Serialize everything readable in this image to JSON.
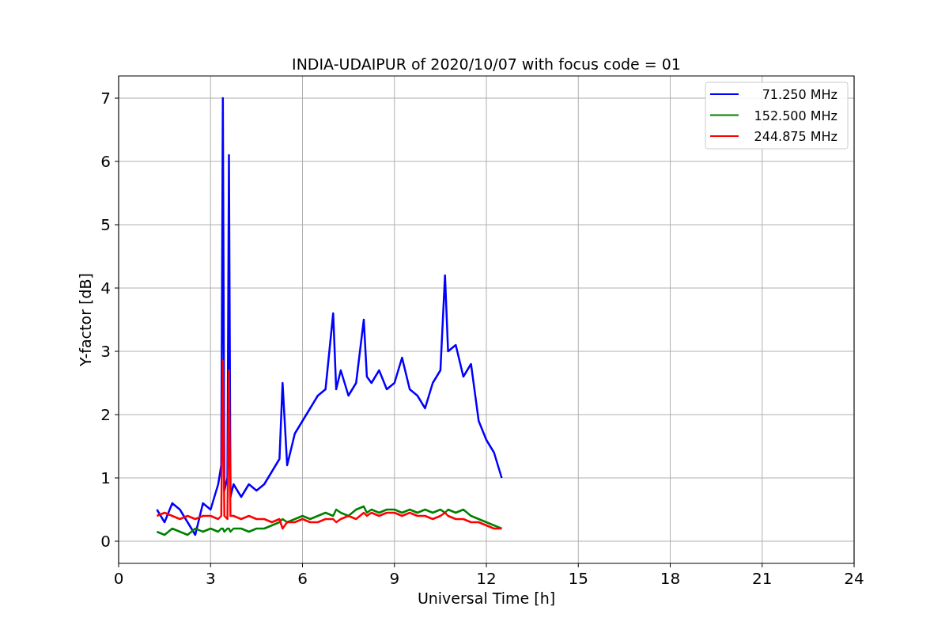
{
  "chart_data": {
    "type": "line",
    "title": "INDIA-UDAIPUR of 2020/10/07 with focus code = 01",
    "xlabel": "Universal Time [h]",
    "ylabel": "Y-factor [dB]",
    "x": [
      1.25,
      1.5,
      1.75,
      2.0,
      2.25,
      2.5,
      2.75,
      3.0,
      3.25,
      3.35,
      3.4,
      3.45,
      3.55,
      3.6,
      3.65,
      3.75,
      4.0,
      4.25,
      4.5,
      4.75,
      5.0,
      5.25,
      5.35,
      5.5,
      5.75,
      6.0,
      6.25,
      6.5,
      6.75,
      7.0,
      7.1,
      7.25,
      7.5,
      7.75,
      8.0,
      8.1,
      8.25,
      8.5,
      8.75,
      9.0,
      9.25,
      9.5,
      9.75,
      10.0,
      10.25,
      10.5,
      10.65,
      10.75,
      11.0,
      11.25,
      11.5,
      11.75,
      12.0,
      12.25,
      12.5
    ],
    "series": [
      {
        "name": "71.250 MHz",
        "color": "#0000ff",
        "values": [
          0.5,
          0.3,
          0.6,
          0.5,
          0.3,
          0.1,
          0.6,
          0.5,
          0.9,
          1.2,
          7.0,
          0.8,
          1.0,
          6.1,
          0.7,
          0.9,
          0.7,
          0.9,
          0.8,
          0.9,
          1.1,
          1.3,
          2.5,
          1.2,
          1.7,
          1.9,
          2.1,
          2.3,
          2.4,
          3.6,
          2.4,
          2.7,
          2.3,
          2.5,
          3.5,
          2.6,
          2.5,
          2.7,
          2.4,
          2.5,
          2.9,
          2.4,
          2.3,
          2.1,
          2.5,
          2.7,
          4.2,
          3.0,
          3.1,
          2.6,
          2.8,
          1.9,
          1.6,
          1.4,
          1.0
        ]
      },
      {
        "name": "152.500 MHz",
        "color": "#008000",
        "values": [
          0.15,
          0.1,
          0.2,
          0.15,
          0.1,
          0.2,
          0.15,
          0.2,
          0.15,
          0.2,
          0.2,
          0.15,
          0.2,
          0.2,
          0.15,
          0.2,
          0.2,
          0.15,
          0.2,
          0.2,
          0.25,
          0.3,
          0.35,
          0.3,
          0.35,
          0.4,
          0.35,
          0.4,
          0.45,
          0.4,
          0.5,
          0.45,
          0.4,
          0.5,
          0.55,
          0.45,
          0.5,
          0.45,
          0.5,
          0.5,
          0.45,
          0.5,
          0.45,
          0.5,
          0.45,
          0.5,
          0.45,
          0.5,
          0.45,
          0.5,
          0.4,
          0.35,
          0.3,
          0.25,
          0.2
        ]
      },
      {
        "name": "244.875 MHz",
        "color": "#ff0000",
        "values": [
          0.4,
          0.45,
          0.4,
          0.35,
          0.4,
          0.35,
          0.4,
          0.4,
          0.35,
          0.4,
          2.85,
          0.4,
          0.35,
          2.7,
          0.4,
          0.4,
          0.35,
          0.4,
          0.35,
          0.35,
          0.3,
          0.35,
          0.2,
          0.3,
          0.3,
          0.35,
          0.3,
          0.3,
          0.35,
          0.35,
          0.3,
          0.35,
          0.4,
          0.35,
          0.45,
          0.4,
          0.45,
          0.4,
          0.45,
          0.45,
          0.4,
          0.45,
          0.4,
          0.4,
          0.35,
          0.4,
          0.45,
          0.4,
          0.35,
          0.35,
          0.3,
          0.3,
          0.25,
          0.2,
          0.2
        ]
      }
    ],
    "grid": true,
    "legend": true,
    "xlim": [
      0,
      24
    ],
    "ylim": [
      -0.35,
      7.35
    ],
    "xticks": [
      0,
      3,
      6,
      9,
      12,
      15,
      18,
      21,
      24
    ],
    "yticks": [
      0,
      1,
      2,
      3,
      4,
      5,
      6,
      7
    ]
  }
}
